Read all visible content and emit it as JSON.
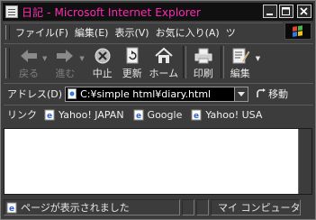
{
  "window": {
    "title": "日記 - Microsoft Internet Explorer",
    "title_color": "#ff2ab4",
    "buttons": [
      "minimize-icon",
      "maximize-icon",
      "close-icon"
    ]
  },
  "menu": {
    "items": [
      "ファイル(F)",
      "編集(E)",
      "表示(V)",
      "お気に入り(A)",
      "ツ"
    ]
  },
  "toolbar": {
    "back": "戻る",
    "forward": "進む",
    "stop": "中止",
    "refresh": "更新",
    "home": "ホーム",
    "print": "印刷",
    "edit": "編集"
  },
  "address": {
    "label": "アドレス(D)",
    "value": "C:¥simple html¥diary.html",
    "go_label": "移動"
  },
  "links": {
    "label": "リンク",
    "items": [
      "Yahoo! JAPAN",
      "Google",
      "Yahoo! USA"
    ]
  },
  "status": {
    "text": "ページが表示されました",
    "zone": "マイ コンピュータ"
  }
}
